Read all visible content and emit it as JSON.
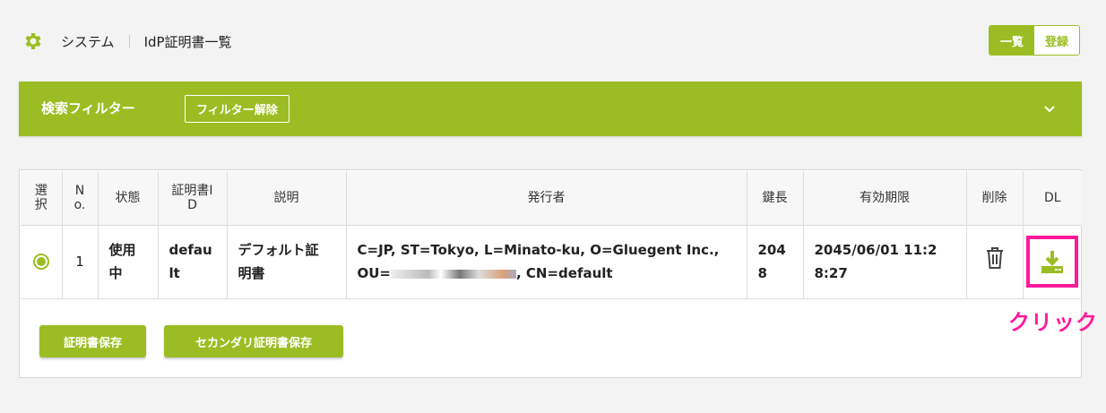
{
  "header": {
    "icon": "gear-icon",
    "breadcrumb": [
      "システム",
      "IdP証明書一覧"
    ]
  },
  "mode_switch": {
    "list_label": "一覧",
    "register_label": "登録"
  },
  "filter": {
    "title": "検索フィルター",
    "clear_label": "フィルター解除",
    "toggle_icon": "chevron-down-icon"
  },
  "table": {
    "headers": {
      "select": "選\n択",
      "no": "N\no.",
      "status": "状態",
      "cert_id": "証明書I\nD",
      "description": "説明",
      "issuer": "発行者",
      "key_length": "鍵長",
      "expiry": "有効期限",
      "delete": "削除",
      "download": "DL"
    },
    "rows": [
      {
        "no": "1",
        "status": "使用\n中",
        "cert_id": "defau\nlt",
        "description": "デフォルト証\n明書",
        "issuer_line1": "C=JP, ST=Tokyo, L=Minato-ku, O=Gluegent Inc.,",
        "issuer_line2": "OU=",
        "issuer_line2_end": ", CN=default",
        "key_length": "204\n8",
        "expiry": "2045/06/01 11:2\n8:27",
        "selected": true
      }
    ]
  },
  "actions": {
    "save_cert": "証明書保存",
    "save_secondary": "セカンダリ証明書保存"
  },
  "annotation": "クリック",
  "colors": {
    "accent": "#9bbd23",
    "highlight": "#ff1a9c"
  }
}
